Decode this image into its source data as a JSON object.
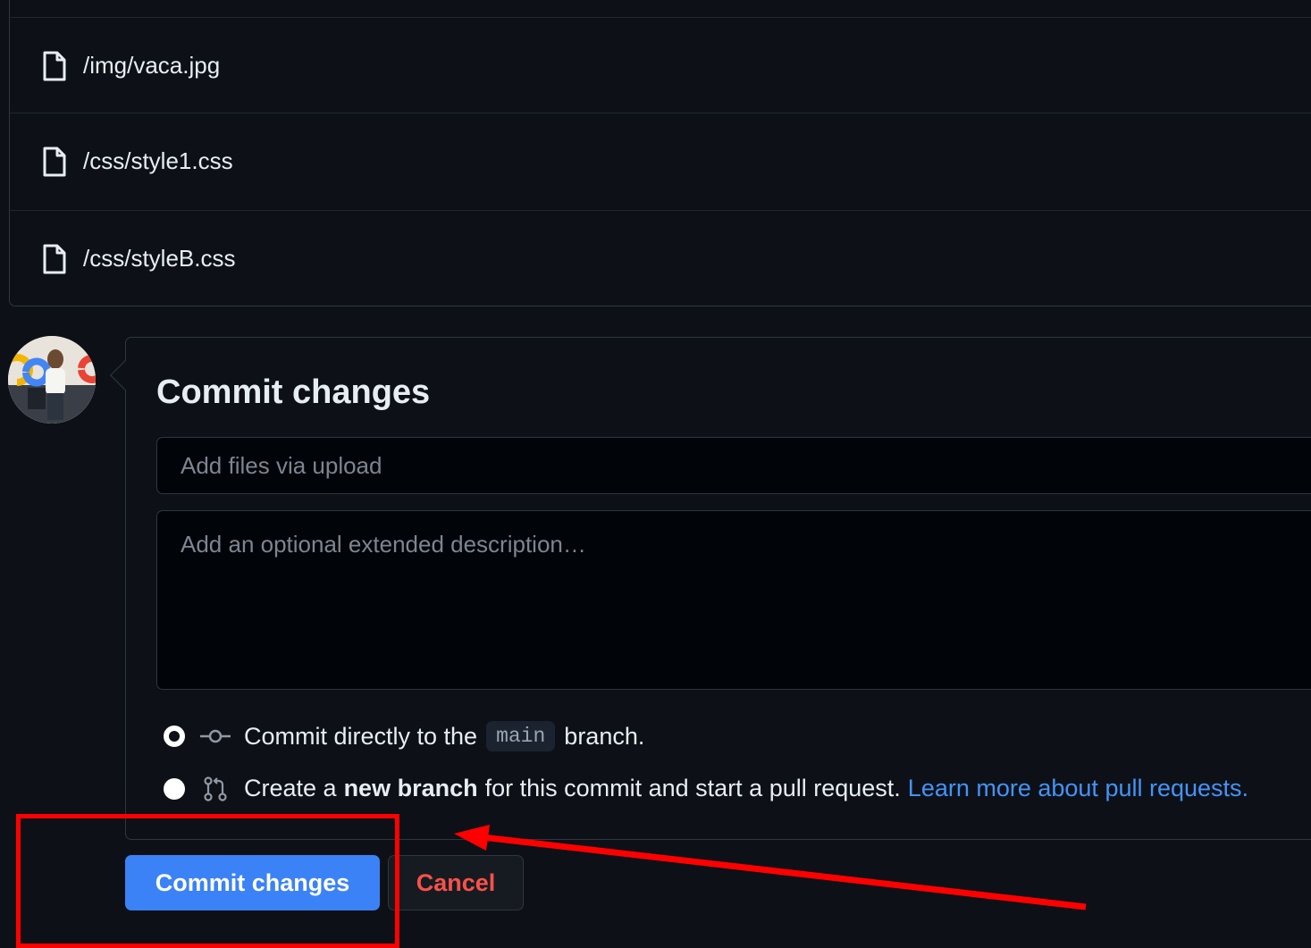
{
  "files": [
    {
      "name": "/img/vaca.jpg",
      "icon": "file-icon"
    },
    {
      "name": "/css/style1.css",
      "icon": "file-icon"
    },
    {
      "name": "/css/styleB.css",
      "icon": "file-icon"
    }
  ],
  "commit": {
    "title": "Commit changes",
    "summary_placeholder": "Add files via upload",
    "description_placeholder": "Add an optional extended description…",
    "option_direct": {
      "prefix": "Commit directly to the",
      "branch": "main",
      "suffix": "branch.",
      "selected": true,
      "icon": "git-commit-icon"
    },
    "option_new_branch": {
      "prefix": "Create a",
      "bold": "new branch",
      "suffix": "for this commit and start a pull request.",
      "link": "Learn more about pull requests.",
      "selected": false,
      "icon": "git-pull-request-icon"
    }
  },
  "actions": {
    "commit_label": "Commit changes",
    "cancel_label": "Cancel"
  },
  "colors": {
    "background": "#0d1117",
    "border": "#30363d",
    "primary_button": "#3b82f6",
    "cancel_text": "#f85149",
    "link": "#4493f8",
    "annotation": "#ff0000"
  }
}
